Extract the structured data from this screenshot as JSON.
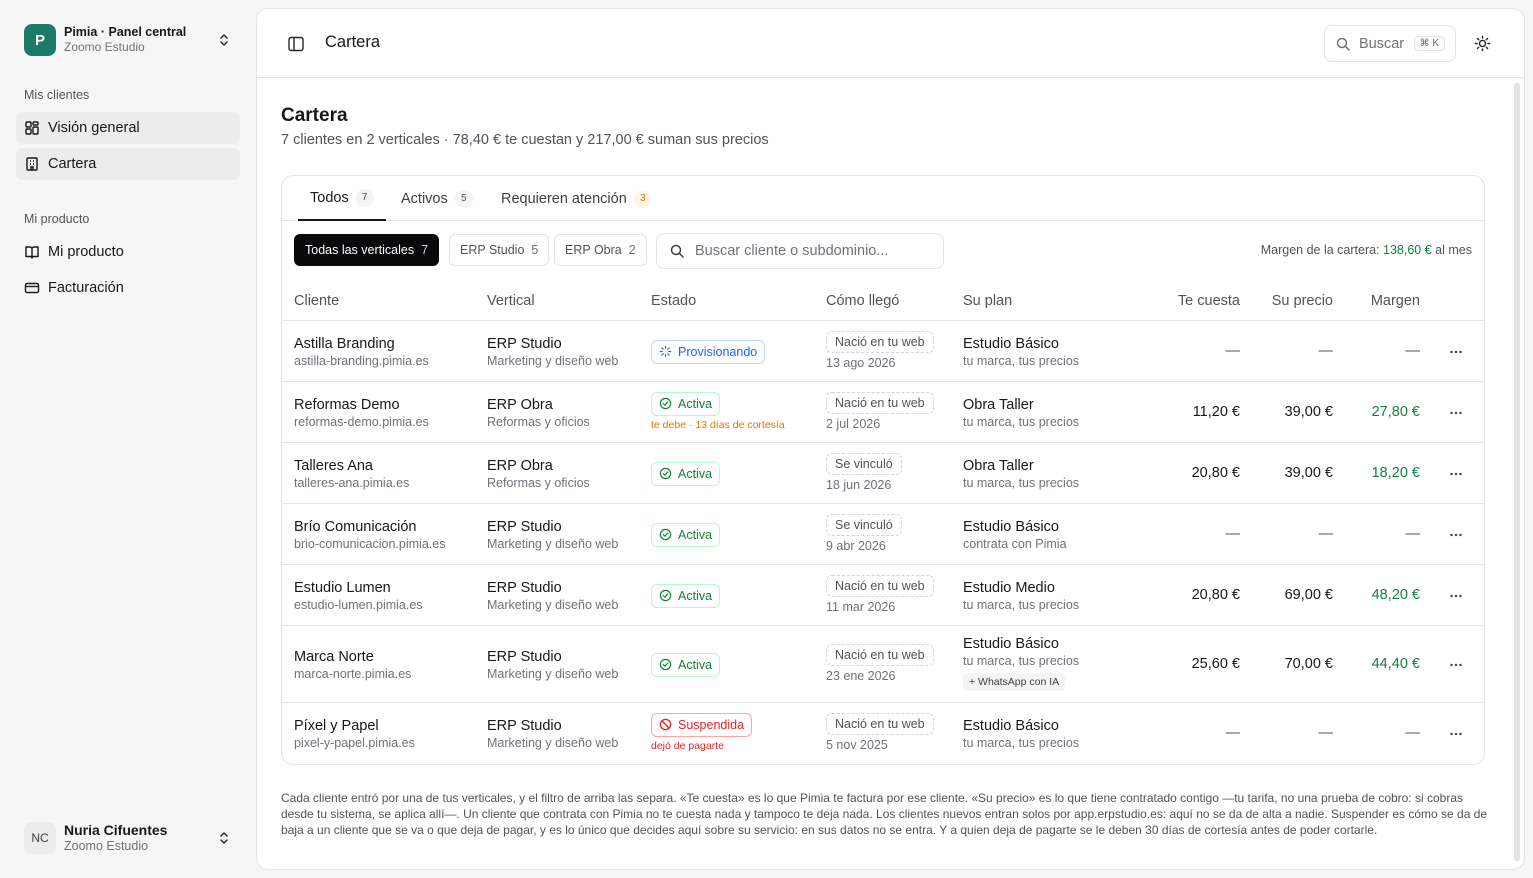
{
  "sidebar": {
    "org": {
      "logo": "P",
      "name": "Pimia · Panel central",
      "sub": "Zoomo Estudio"
    },
    "groups": [
      {
        "label": "Mis clientes",
        "items": [
          {
            "label": "Visión general",
            "icon": "grid-icon"
          },
          {
            "label": "Cartera",
            "icon": "building-icon"
          }
        ]
      },
      {
        "label": "Mi producto",
        "items": [
          {
            "label": "Mi producto",
            "icon": "book-icon"
          },
          {
            "label": "Facturación",
            "icon": "card-icon"
          }
        ]
      }
    ],
    "user": {
      "initials": "NC",
      "name": "Nuria Cifuentes",
      "sub": "Zoomo Estudio"
    }
  },
  "topbar": {
    "title": "Cartera",
    "search_label": "Buscar",
    "search_kbd": "⌘ K"
  },
  "page": {
    "title": "Cartera",
    "subtitle": "7 clientes en 2 verticales · 78,40 € te cuestan y 217,00 € suman sus precios"
  },
  "tabs": [
    {
      "label": "Todos",
      "count": "7"
    },
    {
      "label": "Activos",
      "count": "5"
    },
    {
      "label": "Requieren atención",
      "count": "3"
    }
  ],
  "chips": [
    {
      "label": "Todas las verticales",
      "count": "7"
    },
    {
      "label": "ERP Studio",
      "count": "5"
    },
    {
      "label": "ERP Obra",
      "count": "2"
    }
  ],
  "filter": {
    "placeholder": "Buscar cliente o subdominio..."
  },
  "margin_summary": {
    "label": "Margen de la cartera:",
    "value": "138,60 €",
    "suffix": "al mes"
  },
  "columns": {
    "cliente": "Cliente",
    "vertical": "Vertical",
    "estado": "Estado",
    "origen": "Cómo llegó",
    "plan": "Su plan",
    "coste": "Te cuesta",
    "precio": "Su precio",
    "margen": "Margen"
  },
  "rows": [
    {
      "name": "Astilla Branding",
      "domain": "astilla-branding.pimia.es",
      "vertical": "ERP Studio",
      "vertical_sub": "Marketing y diseño web",
      "estado": "Provisionando",
      "estado_kind": "prov",
      "estado_note": "",
      "origen": "Nació en tu web",
      "fecha": "13 ago 2026",
      "plan": "Estudio Básico",
      "plan_sub": "tu marca, tus precios",
      "addon": "",
      "coste": "—",
      "precio": "—",
      "margen": "—"
    },
    {
      "name": "Reformas Demo",
      "domain": "reformas-demo.pimia.es",
      "vertical": "ERP Obra",
      "vertical_sub": "Reformas y oficios",
      "estado": "Activa",
      "estado_kind": "active",
      "estado_note": "te debe · 13 días de cortesía",
      "origen": "Nació en tu web",
      "fecha": "2 jul 2026",
      "plan": "Obra Taller",
      "plan_sub": "tu marca, tus precios",
      "addon": "",
      "coste": "11,20 €",
      "precio": "39,00 €",
      "margen": "27,80 €"
    },
    {
      "name": "Talleres Ana",
      "domain": "talleres-ana.pimia.es",
      "vertical": "ERP Obra",
      "vertical_sub": "Reformas y oficios",
      "estado": "Activa",
      "estado_kind": "active",
      "estado_note": "",
      "origen": "Se vinculó",
      "fecha": "18 jun 2026",
      "plan": "Obra Taller",
      "plan_sub": "tu marca, tus precios",
      "addon": "",
      "coste": "20,80 €",
      "precio": "39,00 €",
      "margen": "18,20 €"
    },
    {
      "name": "Brío Comunicación",
      "domain": "brio-comunicacion.pimia.es",
      "vertical": "ERP Studio",
      "vertical_sub": "Marketing y diseño web",
      "estado": "Activa",
      "estado_kind": "active",
      "estado_note": "",
      "origen": "Se vinculó",
      "fecha": "9 abr 2026",
      "plan": "Estudio Básico",
      "plan_sub": "contrata con Pimia",
      "addon": "",
      "coste": "—",
      "precio": "—",
      "margen": "—"
    },
    {
      "name": "Estudio Lumen",
      "domain": "estudio-lumen.pimia.es",
      "vertical": "ERP Studio",
      "vertical_sub": "Marketing y diseño web",
      "estado": "Activa",
      "estado_kind": "active",
      "estado_note": "",
      "origen": "Nació en tu web",
      "fecha": "11 mar 2026",
      "plan": "Estudio Medio",
      "plan_sub": "tu marca, tus precios",
      "addon": "",
      "coste": "20,80 €",
      "precio": "69,00 €",
      "margen": "48,20 €"
    },
    {
      "name": "Marca Norte",
      "domain": "marca-norte.pimia.es",
      "vertical": "ERP Studio",
      "vertical_sub": "Marketing y diseño web",
      "estado": "Activa",
      "estado_kind": "active",
      "estado_note": "",
      "origen": "Nació en tu web",
      "fecha": "23 ene 2026",
      "plan": "Estudio Básico",
      "plan_sub": "tu marca, tus precios",
      "addon": "+ WhatsApp con IA",
      "coste": "25,60 €",
      "precio": "70,00 €",
      "margen": "44,40 €"
    },
    {
      "name": "Píxel y Papel",
      "domain": "pixel-y-papel.pimia.es",
      "vertical": "ERP Studio",
      "vertical_sub": "Marketing y diseño web",
      "estado": "Suspendida",
      "estado_kind": "susp",
      "estado_note": "dejó de pagarte",
      "origen": "Nació en tu web",
      "fecha": "5 nov 2025",
      "plan": "Estudio Básico",
      "plan_sub": "tu marca, tus precios",
      "addon": "",
      "coste": "—",
      "precio": "—",
      "margen": "—"
    }
  ],
  "footnote": "Cada cliente entró por una de tus verticales, y el filtro de arriba las separa. «Te cuesta» es lo que Pimia te factura por ese cliente. «Su precio» es lo que tiene contratado contigo —tu tarifa, no una prueba de cobro: si cobras desde tu sistema, se aplica allí—. Un cliente que contrata con Pimia no te cuesta nada y tampoco te deja nada. Los clientes nuevos entran solos por app.erpstudio.es: aquí no se da de alta a nadie. Suspender es cómo se da de baja a un cliente que se va o que deja de pagar, y es lo único que decides aquí sobre su servicio: en sus datos no se entra. Y a quien deja de pagarte se le deben 30 días de cortesía antes de poder cortarle.",
  "colors": {
    "accent": "#1e7a68",
    "positive": "#15803d",
    "warning": "#d97706",
    "danger": "#dc2626",
    "info": "#2563eb"
  }
}
